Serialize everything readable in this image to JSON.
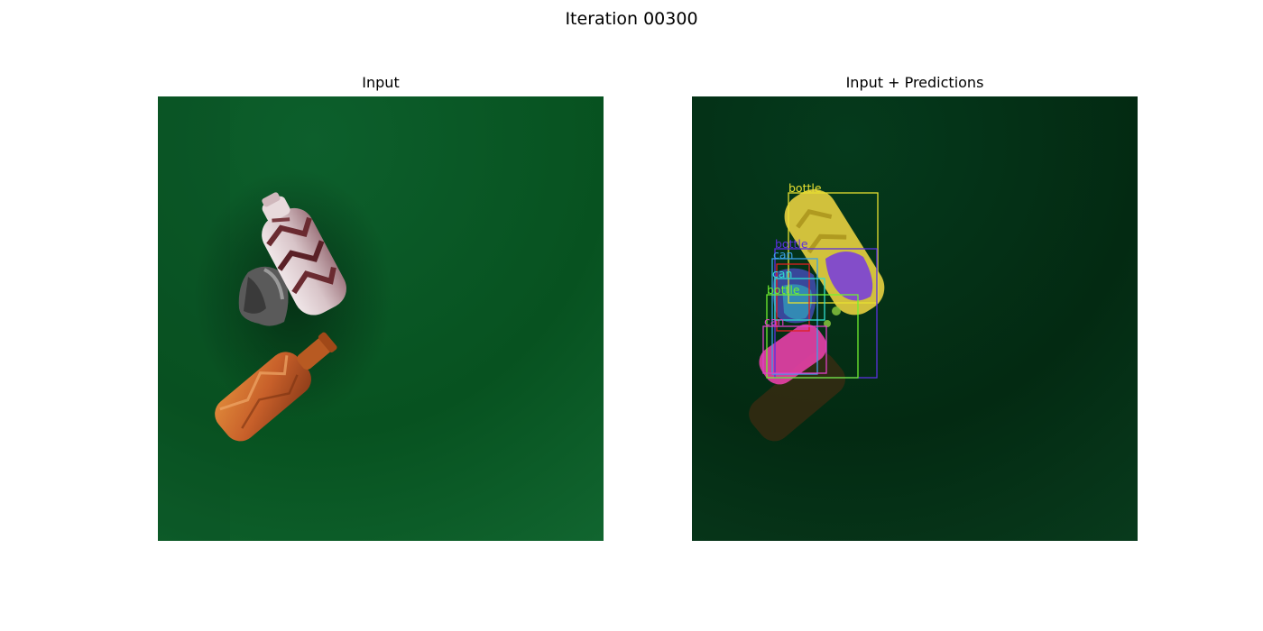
{
  "figure": {
    "title": "Iteration 00300"
  },
  "panels": {
    "input_title": "Input",
    "predictions_title": "Input + Predictions"
  },
  "detections": [
    {
      "label": "bottle",
      "color": "#e8e030"
    },
    {
      "label": "bottle",
      "color": "#5a30e0"
    },
    {
      "label": "can",
      "color": "#3aa0e8"
    },
    {
      "label": "can",
      "color": "#30e0d0"
    },
    {
      "label": "bottle",
      "color": "#70f030"
    },
    {
      "label": "can",
      "color": "#e040c8"
    }
  ],
  "colors": {
    "background_green": "#0d5a2a",
    "prediction_background": "#05301a",
    "red_box": "#e02020"
  }
}
